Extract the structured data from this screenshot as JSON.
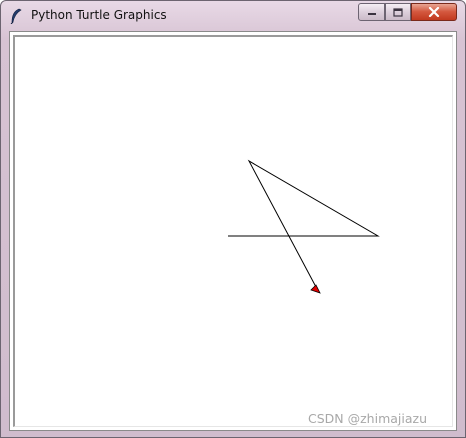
{
  "window": {
    "title": "Python Turtle Graphics",
    "icon": "feather-icon"
  },
  "controls": {
    "minimize_icon": "minimize-icon",
    "maximize_icon": "maximize-icon",
    "close_icon": "close-icon",
    "close_color": "#c8432a"
  },
  "canvas": {
    "background": "#ffffff",
    "line_color": "#000000",
    "turtle_color": "#e00000",
    "turtle_icon": "turtle-arrow-icon"
  },
  "watermark": {
    "text": "CSDN @zhimajiazu"
  }
}
